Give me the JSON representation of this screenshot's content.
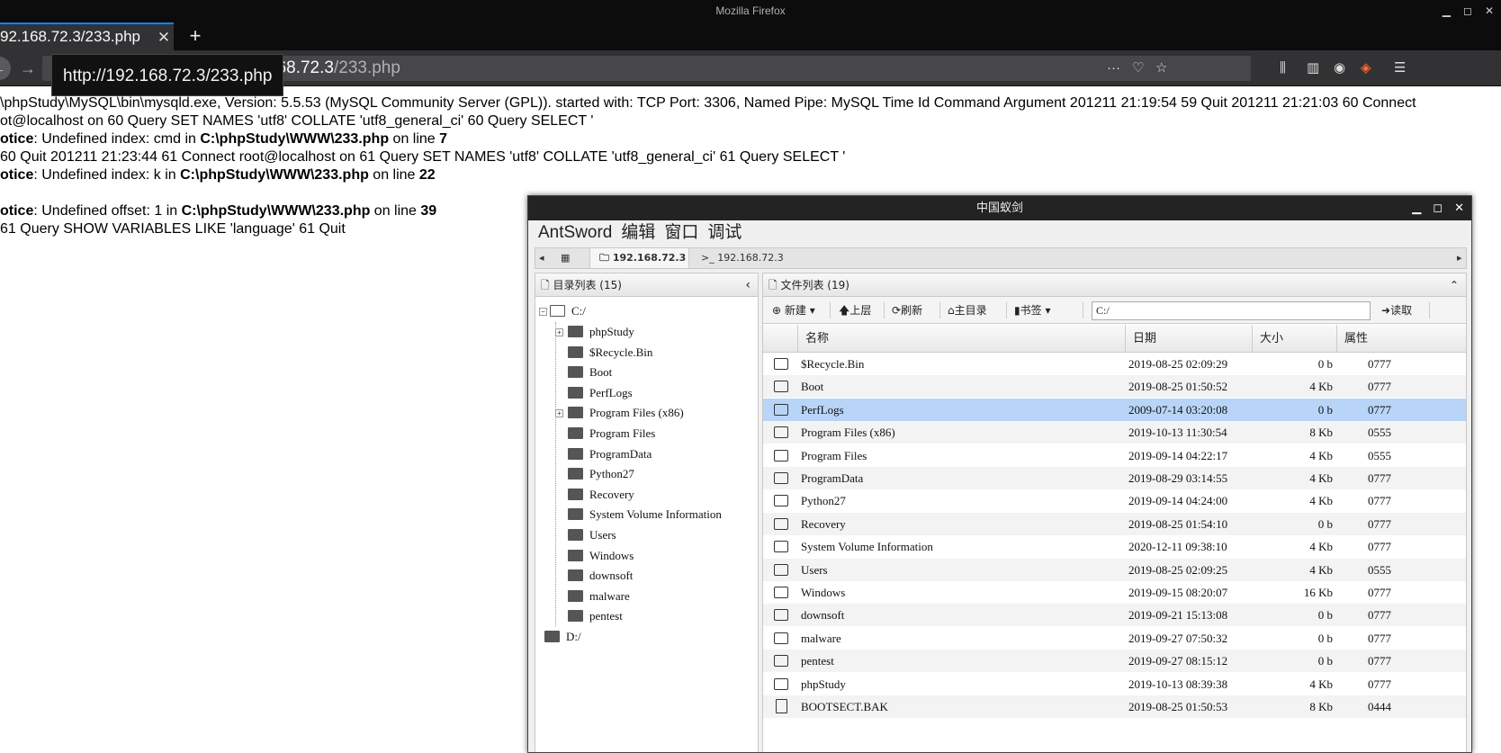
{
  "window": {
    "title": "Mozilla Firefox",
    "min": "▁",
    "max": "◻",
    "close": "✕"
  },
  "tab": {
    "title": "92.168.72.3/233.php",
    "close": "✕",
    "new": "+"
  },
  "nav": {
    "back": "←",
    "forward": "→",
    "url_host": "168.72.3",
    "url_path": "/233.php",
    "tooltip": "http://192.168.72.3/233.php",
    "icons": [
      "···",
      "♡",
      "☆",
      "⫼",
      "▥",
      "◉",
      "◈",
      "☰"
    ]
  },
  "page_lines": [
    {
      "text": "\\phpStudy\\MySQL\\bin\\mysqld.exe, Version: 5.5.53 (MySQL Community Server (GPL)). started with: TCP Port: 3306, Named Pipe: MySQL Time Id Command Argument 201211 21:19:54 59 Quit 201211 21:21:03 60 Connect"
    },
    {
      "text": "ot@localhost on 60 Query SET NAMES 'utf8' COLLATE 'utf8_general_ci' 60 Query SELECT '"
    },
    {
      "pre": "otice",
      "mid": ": Undefined index: cmd in ",
      "file": "C:\\phpStudy\\WWW\\233.php",
      "post": " on line ",
      "num": "7"
    },
    {
      "text": "60 Quit 201211 21:23:44 61 Connect root@localhost on 61 Query SET NAMES 'utf8' COLLATE 'utf8_general_ci' 61 Query SELECT '"
    },
    {
      "pre": "otice",
      "mid": ": Undefined index: k in ",
      "file": "C:\\phpStudy\\WWW\\233.php",
      "post": " on line ",
      "num": "22"
    },
    {
      "pre": "otice",
      "mid": ": Undefined offset: 1 in ",
      "file": "C:\\phpStudy\\WWW\\233.php",
      "post": " on line ",
      "num": "39"
    },
    {
      "text": "61 Query SHOW VARIABLES LIKE 'language' 61 Quit"
    }
  ],
  "ant": {
    "title": "中国蚁剑",
    "menu": [
      "AntSword",
      "编辑",
      "窗口",
      "调试"
    ],
    "tabs": {
      "home_icon": "▦",
      "file_tab": "192.168.72.3",
      "term_tab": "192.168.72.3",
      "left_arrow": "◂",
      "right_arrow": "▸"
    },
    "dir_panel": {
      "title": "目录列表 (15)",
      "collapse": "‹"
    },
    "tree": {
      "root": "C:/",
      "children": [
        "phpStudy",
        "$Recycle.Bin",
        "Boot",
        "PerfLogs",
        "Program Files (x86)",
        "Program Files",
        "ProgramData",
        "Python27",
        "Recovery",
        "System Volume Information",
        "Users",
        "Windows",
        "downsoft",
        "malware",
        "pentest"
      ],
      "d": "D:/"
    },
    "file_panel": {
      "title": "文件列表 (19)",
      "collapse": "⌃"
    },
    "toolbar": {
      "new": "新建",
      "up": "上层",
      "refresh": "刷新",
      "home": "主目录",
      "bookmark": "书签",
      "path": "C:/",
      "read": "读取"
    },
    "columns": [
      "名称",
      "日期",
      "大小",
      "属性"
    ],
    "rows": [
      {
        "name": "$Recycle.Bin",
        "date": "2019-08-25 02:09:29",
        "size": "0 b",
        "attr": "0777",
        "type": "folder"
      },
      {
        "name": "Boot",
        "date": "2019-08-25 01:50:52",
        "size": "4 Kb",
        "attr": "0777",
        "type": "folder"
      },
      {
        "name": "PerfLogs",
        "date": "2009-07-14 03:20:08",
        "size": "0 b",
        "attr": "0777",
        "type": "folder"
      },
      {
        "name": "Program Files (x86)",
        "date": "2019-10-13 11:30:54",
        "size": "8 Kb",
        "attr": "0555",
        "type": "folder"
      },
      {
        "name": "Program Files",
        "date": "2019-09-14 04:22:17",
        "size": "4 Kb",
        "attr": "0555",
        "type": "folder"
      },
      {
        "name": "ProgramData",
        "date": "2019-08-29 03:14:55",
        "size": "4 Kb",
        "attr": "0777",
        "type": "folder"
      },
      {
        "name": "Python27",
        "date": "2019-09-14 04:24:00",
        "size": "4 Kb",
        "attr": "0777",
        "type": "folder"
      },
      {
        "name": "Recovery",
        "date": "2019-08-25 01:54:10",
        "size": "0 b",
        "attr": "0777",
        "type": "folder"
      },
      {
        "name": "System Volume Information",
        "date": "2020-12-11 09:38:10",
        "size": "4 Kb",
        "attr": "0777",
        "type": "folder"
      },
      {
        "name": "Users",
        "date": "2019-08-25 02:09:25",
        "size": "4 Kb",
        "attr": "0555",
        "type": "folder"
      },
      {
        "name": "Windows",
        "date": "2019-09-15 08:20:07",
        "size": "16 Kb",
        "attr": "0777",
        "type": "folder"
      },
      {
        "name": "downsoft",
        "date": "2019-09-21 15:13:08",
        "size": "0 b",
        "attr": "0777",
        "type": "folder"
      },
      {
        "name": "malware",
        "date": "2019-09-27 07:50:32",
        "size": "0 b",
        "attr": "0777",
        "type": "folder"
      },
      {
        "name": "pentest",
        "date": "2019-09-27 08:15:12",
        "size": "0 b",
        "attr": "0777",
        "type": "folder"
      },
      {
        "name": "phpStudy",
        "date": "2019-10-13 08:39:38",
        "size": "4 Kb",
        "attr": "0777",
        "type": "folder"
      },
      {
        "name": "BOOTSECT.BAK",
        "date": "2019-08-25 01:50:53",
        "size": "8 Kb",
        "attr": "0444",
        "type": "file"
      }
    ],
    "selected_row": 2
  },
  "colors": {
    "accent": "#0a84ff",
    "selection": "#b8d5f7",
    "chrome": "#323234"
  }
}
